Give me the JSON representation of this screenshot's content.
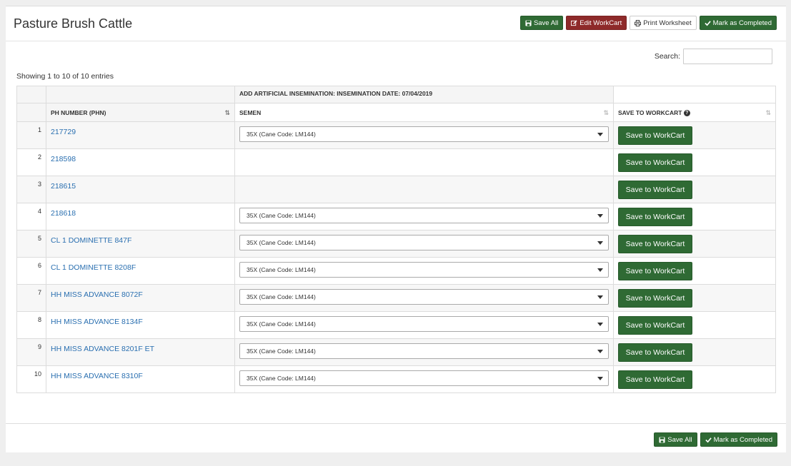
{
  "page": {
    "title": "Pasture Brush Cattle"
  },
  "header_buttons": {
    "save_all": "Save All",
    "edit_workcart": "Edit WorkCart",
    "print_worksheet": "Print Worksheet",
    "mark_completed": "Mark as Completed"
  },
  "search": {
    "label": "Search:",
    "value": ""
  },
  "table_info": "Showing 1 to 10 of 10 entries",
  "table": {
    "group_header": "ADD ARTIFICIAL INSEMINATION: INSEMINATION DATE: 07/04/2019",
    "columns": {
      "phn": "PH NUMBER (PHN)",
      "semen": "SEMEN",
      "save": "SAVE TO WORKCART"
    },
    "rows": [
      {
        "num": "1",
        "phn": "217729",
        "semen": "35X (Cane Code: LM144)",
        "has_semen": true,
        "action": "Save to WorkCart"
      },
      {
        "num": "2",
        "phn": "218598",
        "semen": "",
        "has_semen": false,
        "action": "Save to WorkCart"
      },
      {
        "num": "3",
        "phn": "218615",
        "semen": "",
        "has_semen": false,
        "action": "Save to WorkCart"
      },
      {
        "num": "4",
        "phn": "218618",
        "semen": "35X (Cane Code: LM144)",
        "has_semen": true,
        "action": "Save to WorkCart"
      },
      {
        "num": "5",
        "phn": "CL 1 DOMINETTE 847F",
        "semen": "35X (Cane Code: LM144)",
        "has_semen": true,
        "action": "Save to WorkCart"
      },
      {
        "num": "6",
        "phn": "CL 1 DOMINETTE 8208F",
        "semen": "35X (Cane Code: LM144)",
        "has_semen": true,
        "action": "Save to WorkCart"
      },
      {
        "num": "7",
        "phn": "HH MISS ADVANCE 8072F",
        "semen": "35X (Cane Code: LM144)",
        "has_semen": true,
        "action": "Save to WorkCart"
      },
      {
        "num": "8",
        "phn": "HH MISS ADVANCE 8134F",
        "semen": "35X (Cane Code: LM144)",
        "has_semen": true,
        "action": "Save to WorkCart"
      },
      {
        "num": "9",
        "phn": "HH MISS ADVANCE 8201F ET",
        "semen": "35X (Cane Code: LM144)",
        "has_semen": true,
        "action": "Save to WorkCart"
      },
      {
        "num": "10",
        "phn": "HH MISS ADVANCE 8310F",
        "semen": "35X (Cane Code: LM144)",
        "has_semen": true,
        "action": "Save to WorkCart"
      }
    ]
  },
  "footer_buttons": {
    "save_all": "Save All",
    "mark_completed": "Mark as Completed"
  },
  "colors": {
    "primary_green": "#2f6a34",
    "danger_red": "#8e2a2a",
    "link_blue": "#2a6fb0"
  }
}
